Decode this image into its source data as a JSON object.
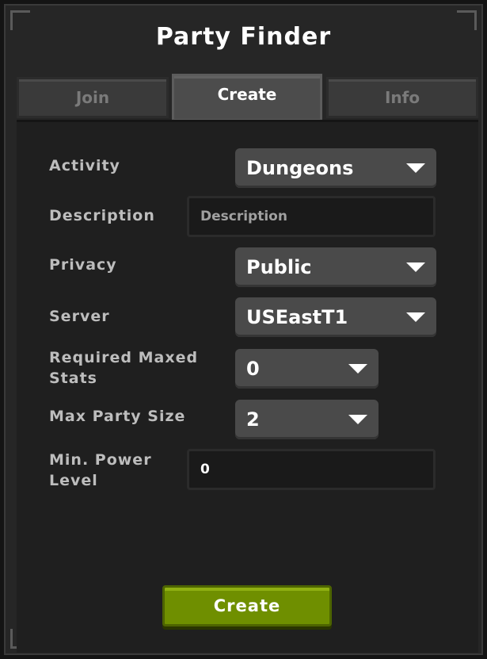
{
  "window": {
    "title": "Party Finder"
  },
  "tabs": [
    {
      "label": "Join",
      "active": false
    },
    {
      "label": "Create",
      "active": true
    },
    {
      "label": "Info",
      "active": false
    }
  ],
  "form": {
    "activity": {
      "label": "Activity",
      "value": "Dungeons"
    },
    "description": {
      "label": "Description",
      "placeholder": "Description",
      "value": ""
    },
    "privacy": {
      "label": "Privacy",
      "value": "Public"
    },
    "server": {
      "label": "Server",
      "value": "USEastT1"
    },
    "required_maxed_stats": {
      "label_line1": "Required Maxed",
      "label_line2": "Stats",
      "value": "0"
    },
    "max_party_size": {
      "label": "Max Party Size",
      "value": "2"
    },
    "min_power_level": {
      "label_line1": "Min. Power",
      "label_line2": "Level",
      "value": "0"
    }
  },
  "actions": {
    "create_label": "Create"
  },
  "colors": {
    "window_bg": "#262626",
    "panel_bg": "#1f1f1f",
    "dropdown_bg": "#4a4a4a",
    "create_button": "#6f8f00"
  },
  "icons": {
    "dropdown": "caret-down-icon"
  }
}
